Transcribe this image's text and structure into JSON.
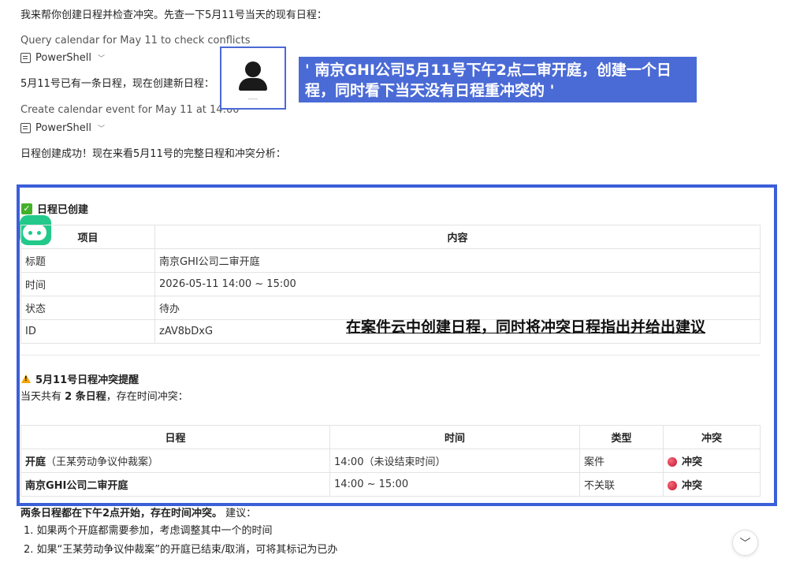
{
  "messages": {
    "intro": "我来帮你创建日程并检查冲突。先查一下5月11号当天的现有日程：",
    "tool1_desc": "Query calendar for May 11 to check conflicts",
    "tool1_name": "PowerShell",
    "existing_note": "5月11号已有一条日程，现在创建新日程：",
    "tool2_desc": "Create calendar event for May 11 at 14:00",
    "tool2_name": "PowerShell",
    "success": "日程创建成功！现在来看5月11号的完整日程和冲突分析："
  },
  "prompt_text": "' 南京GHI公司5月11号下午2点二审开庭，创建一个日程，同时看下当天没有日程重冲突的 '",
  "created": {
    "title": "日程已创建",
    "headers": [
      "项目",
      "内容"
    ],
    "rows": [
      [
        "标题",
        "南京GHI公司二审开庭"
      ],
      [
        "时间",
        "2026-05-11 14:00 ~ 15:00"
      ],
      [
        "状态",
        "待办"
      ],
      [
        "ID",
        "zAV8bDxG"
      ]
    ]
  },
  "caption": "在案件云中创建日程，同时将冲突日程指出并给出建议",
  "conflict": {
    "title": "5月11号日程冲突提醒",
    "summary_pre": "当天共有 ",
    "summary_bold": "2 条日程",
    "summary_post": "，存在时间冲突：",
    "headers": [
      "日程",
      "时间",
      "类型",
      "冲突"
    ],
    "rows": [
      {
        "name_bold": "开庭",
        "name_rest": "（王某劳动争议仲裁案）",
        "time": "14:00（未设结束时间）",
        "type": "案件",
        "conflict": "冲突"
      },
      {
        "name_bold": "南京GHI公司二审开庭",
        "name_rest": "",
        "time": "14:00 ~ 15:00",
        "type": "不关联",
        "conflict": "冲突"
      }
    ]
  },
  "advice": {
    "lead_bold": "两条日程都在下午2点开始，存在时间冲突。",
    "lead_rest": " 建议：",
    "items": [
      "1. 如果两个开庭都需要参加，考虑调整其中一个的时间",
      "2. 如果“王某劳动争议仲裁案”的开庭已结束/取消，可将其标记为已办"
    ]
  },
  "colors": {
    "accent": "#3b5fd9",
    "prompt_bg": "#4a6ad6",
    "conflict_dot": "#c8102e",
    "check": "#43b02a"
  }
}
